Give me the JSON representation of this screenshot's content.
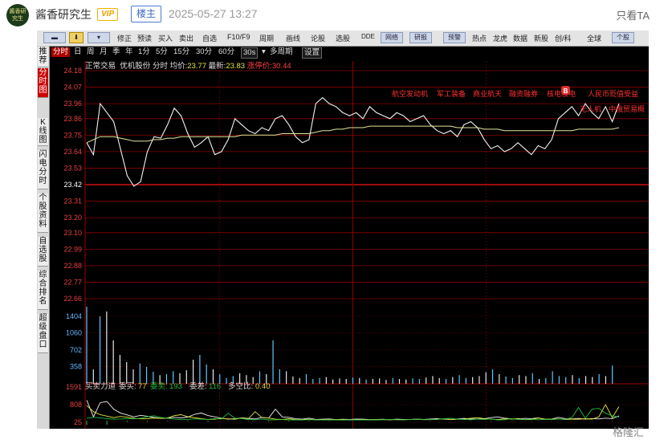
{
  "post": {
    "avatar_text": "酱香研究生",
    "username": "酱香研究生",
    "vip_badge": "VIP",
    "op_badge": "楼主",
    "timestamp": "2025-05-27 13:27",
    "only_view": "只看TA",
    "watermark": "格隆汇"
  },
  "toolbar": {
    "items": [
      "修正",
      "预读",
      "买入",
      "卖出",
      "自选",
      "F10/F9",
      "周期",
      "画线",
      "论股",
      "选股",
      "DDE",
      "网络",
      "研报",
      "预警",
      "热点",
      "龙虎",
      "数据",
      "新股",
      "创/科",
      "全球",
      "个股"
    ]
  },
  "sidebar": {
    "tabs": [
      {
        "label": "推荐",
        "active": false
      },
      {
        "label": "分时图",
        "active": true
      },
      {
        "label": "K线图",
        "active": false
      },
      {
        "label": "闪电分时",
        "active": false
      },
      {
        "label": "个股资料",
        "active": false
      },
      {
        "label": "自选股",
        "active": false
      },
      {
        "label": "综合排名",
        "active": false
      },
      {
        "label": "超级盘口",
        "active": false
      }
    ]
  },
  "period_bar": {
    "items": [
      "分时",
      "日",
      "周",
      "月",
      "季",
      "年",
      "1分",
      "5分",
      "15分",
      "30分",
      "60分",
      "30s",
      "多周期",
      "设置"
    ]
  },
  "info_line": {
    "trading_status": "正常交易",
    "stock_name": "优机股份",
    "mode": "分时",
    "avg_label": "均价:",
    "avg_value": "23.77",
    "last_label": "最新:",
    "last_value": "23.83",
    "limit_label": "涨停价:",
    "limit_value": "30.44"
  },
  "price_axis": {
    "ticks": [
      "24.18",
      "24.07",
      "23.96",
      "23.86",
      "23.75",
      "23.64",
      "23.53",
      "23.42",
      "23.31",
      "23.20",
      "23.10",
      "22.99",
      "22.88",
      "22.77",
      "22.66"
    ],
    "ref_price": "23.42"
  },
  "volume_axis": {
    "ticks": [
      "1404",
      "1060",
      "702",
      "358"
    ]
  },
  "indicator": {
    "name": "买卖力道",
    "buy_label": "委买:",
    "buy_value": "77",
    "sell_label": "委卖:",
    "sell_value": "193",
    "diff_label": "委差:",
    "diff_value": "116",
    "ratio_label": "多空比:",
    "ratio_value": "0.40",
    "ticks": [
      "1591",
      "808",
      "25"
    ]
  },
  "concept_tags": [
    "航空发动机",
    "军工装备",
    "商业航天",
    "融资融券",
    "核电核电",
    "人民币贬值受益",
    "无人机",
    "中俄贸易概"
  ],
  "marker_badge": "B",
  "chart_data": {
    "type": "line",
    "title": "优机股份 分时",
    "ylim": [
      22.66,
      24.18
    ],
    "series": [
      {
        "name": "最新",
        "values": [
          23.7,
          23.62,
          23.96,
          23.9,
          23.84,
          23.66,
          23.48,
          23.41,
          23.44,
          23.64,
          23.74,
          23.73,
          23.82,
          23.93,
          23.88,
          23.76,
          23.67,
          23.7,
          23.74,
          23.62,
          23.64,
          23.72,
          23.86,
          23.82,
          23.78,
          23.76,
          23.8,
          23.78,
          23.86,
          23.88,
          23.82,
          23.74,
          23.7,
          23.72,
          23.96,
          24.0,
          23.96,
          23.94,
          23.9,
          23.88,
          23.9,
          23.86,
          23.94,
          23.9,
          23.88,
          23.86,
          23.9,
          23.88,
          23.84,
          23.86,
          23.88,
          23.82,
          23.78,
          23.76,
          23.78,
          23.74,
          23.82,
          23.84,
          23.8,
          23.72,
          23.66,
          23.68,
          23.64,
          23.66,
          23.7,
          23.66,
          23.62,
          23.68,
          23.66,
          23.72,
          23.86,
          23.9,
          23.94,
          23.88,
          23.96,
          23.9,
          23.86,
          23.94,
          23.84,
          23.96
        ]
      },
      {
        "name": "均价",
        "values": [
          23.7,
          23.72,
          23.74,
          23.74,
          23.74,
          23.73,
          23.72,
          23.71,
          23.71,
          23.71,
          23.72,
          23.72,
          23.73,
          23.73,
          23.74,
          23.74,
          23.74,
          23.74,
          23.74,
          23.74,
          23.74,
          23.74,
          23.74,
          23.75,
          23.75,
          23.75,
          23.75,
          23.75,
          23.75,
          23.76,
          23.76,
          23.76,
          23.76,
          23.76,
          23.77,
          23.78,
          23.78,
          23.79,
          23.79,
          23.8,
          23.8,
          23.8,
          23.81,
          23.81,
          23.81,
          23.81,
          23.81,
          23.81,
          23.81,
          23.81,
          23.81,
          23.81,
          23.81,
          23.81,
          23.81,
          23.8,
          23.8,
          23.8,
          23.8,
          23.79,
          23.79,
          23.79,
          23.78,
          23.78,
          23.78,
          23.78,
          23.78,
          23.78,
          23.78,
          23.78,
          23.78,
          23.78,
          23.78,
          23.79,
          23.79,
          23.79,
          23.79,
          23.79,
          23.79,
          23.8
        ]
      }
    ],
    "volume": [
      1600,
      300,
      1400,
      1500,
      900,
      600,
      450,
      300,
      420,
      350,
      250,
      180,
      200,
      260,
      220,
      280,
      500,
      600,
      400,
      300,
      200,
      120,
      160,
      220,
      180,
      140,
      260,
      200,
      900,
      300,
      260,
      150,
      120,
      200,
      100,
      120,
      140,
      90,
      110,
      100,
      130,
      120,
      90,
      100,
      110,
      80,
      120,
      100,
      90,
      110,
      100,
      130,
      160,
      120,
      100,
      140,
      180,
      120,
      140,
      160,
      240,
      300,
      200,
      150,
      120,
      180,
      160,
      220,
      100,
      120,
      260,
      160,
      140,
      180,
      120,
      160,
      140,
      200,
      160,
      380
    ]
  }
}
